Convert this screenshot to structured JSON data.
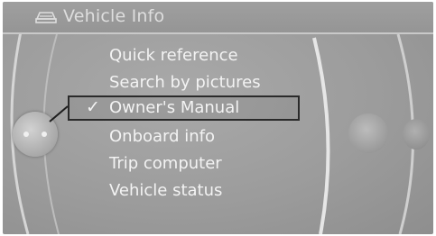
{
  "header": {
    "title": "Vehicle Info",
    "icon": "car-info-icon"
  },
  "menu": {
    "items": [
      {
        "label": "Quick reference",
        "selected": false
      },
      {
        "label": "Search by pictures",
        "selected": false
      },
      {
        "label": "Owner's Manual",
        "selected": true
      },
      {
        "label": "Onboard info",
        "selected": false
      },
      {
        "label": "Trip computer",
        "selected": false
      },
      {
        "label": "Vehicle status",
        "selected": false
      }
    ],
    "check_glyph": "✓"
  },
  "colors": {
    "background": "#9c9c9c",
    "text": "#f3f3f3",
    "selection_border": "#2a2a2a"
  }
}
